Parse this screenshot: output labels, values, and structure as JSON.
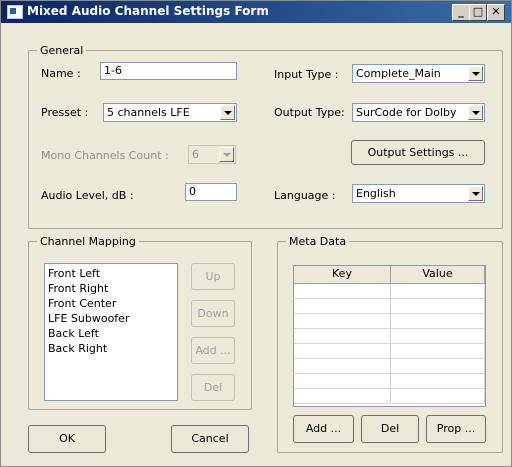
{
  "window": {
    "title": "Mixed Audio Channel Settings Form"
  },
  "general": {
    "title": "General",
    "name_label": "Name :",
    "name_value": "1-6",
    "presset_label": "Presset :",
    "presset_value": "5 channels LFE",
    "mono_label": "Mono Channels Count :",
    "mono_value": "6",
    "audio_label": "Audio Level, dB :",
    "audio_value": "0",
    "input_type_label": "Input Type :",
    "input_type_value": "Complete_Main",
    "output_type_label": "Output Type:",
    "output_type_value": "SurCode for Dolby",
    "output_settings_label": "Output Settings ...",
    "language_label": "Language :",
    "language_value": "English"
  },
  "channel_mapping": {
    "title": "Channel Mapping",
    "items": [
      "Front Left",
      "Front Right",
      "Front Center",
      "LFE Subwoofer",
      "Back Left",
      "Back Right"
    ],
    "up_label": "Up",
    "down_label": "Down",
    "add_label": "Add ...",
    "del_label": "Del"
  },
  "meta_data": {
    "title": "Meta Data",
    "columns": [
      "Key",
      "Value"
    ],
    "add_label": "Add ...",
    "del_label": "Del",
    "prop_label": "Prop ..."
  },
  "footer": {
    "ok_label": "OK",
    "cancel_label": "Cancel"
  }
}
